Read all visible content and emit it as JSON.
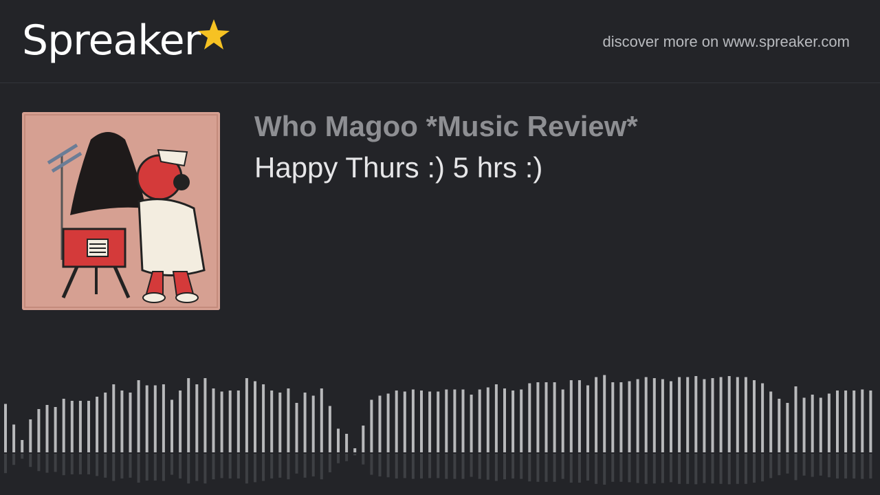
{
  "brand": {
    "name": "Spreaker",
    "discover_text": "discover more on www.spreaker.com",
    "star_color": "#f6c223"
  },
  "show": {
    "title": "Who Magoo *Music Review*",
    "episode_title": "Happy Thurs :) 5 hrs :)",
    "cover_icon": "podcast-cover-art"
  },
  "waveform": {
    "bar_color": "#b8b9bb",
    "reflection_color": "#55575b",
    "levels": [
      0.47,
      0.27,
      0.12,
      0.32,
      0.42,
      0.46,
      0.44,
      0.52,
      0.5,
      0.5,
      0.5,
      0.54,
      0.58,
      0.66,
      0.6,
      0.58,
      0.7,
      0.65,
      0.65,
      0.66,
      0.51,
      0.6,
      0.72,
      0.66,
      0.72,
      0.62,
      0.59,
      0.6,
      0.6,
      0.72,
      0.69,
      0.66,
      0.6,
      0.58,
      0.62,
      0.48,
      0.58,
      0.55,
      0.62,
      0.45,
      0.23,
      0.18,
      0.04,
      0.26,
      0.51,
      0.55,
      0.57,
      0.6,
      0.59,
      0.61,
      0.6,
      0.59,
      0.59,
      0.61,
      0.61,
      0.61,
      0.56,
      0.61,
      0.63,
      0.66,
      0.62,
      0.6,
      0.61,
      0.67,
      0.68,
      0.68,
      0.68,
      0.61,
      0.7,
      0.7,
      0.65,
      0.73,
      0.75,
      0.68,
      0.68,
      0.69,
      0.71,
      0.73,
      0.72,
      0.71,
      0.69,
      0.73,
      0.73,
      0.74,
      0.71,
      0.72,
      0.73,
      0.74,
      0.73,
      0.73,
      0.7,
      0.67,
      0.59,
      0.52,
      0.48,
      0.64,
      0.53,
      0.56,
      0.53,
      0.57,
      0.6,
      0.6,
      0.6,
      0.61,
      0.6,
      0.56,
      0.61,
      0.64,
      0.65,
      0.66,
      0.67,
      0.66,
      0.66,
      0.68,
      0.66,
      0.68,
      0.7,
      0.7
    ]
  }
}
